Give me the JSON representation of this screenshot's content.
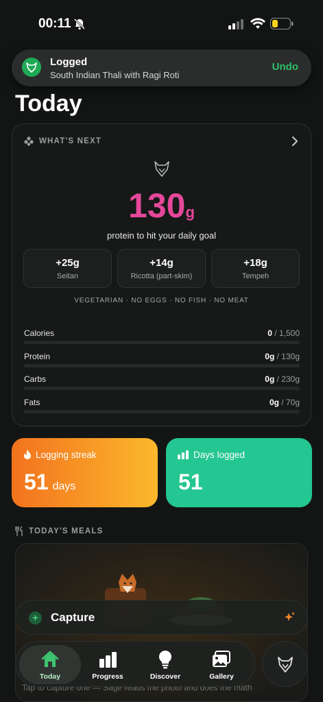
{
  "status_bar": {
    "time": "00:11",
    "icons": [
      "bell-slash-icon",
      "signal-icon",
      "wifi-icon",
      "battery-low-icon"
    ]
  },
  "toast": {
    "title": "Logged",
    "subtitle": "South Indian Thali with Ragi Roti",
    "action": "Undo"
  },
  "page_title": "Today",
  "whats_next": {
    "label": "WHAT'S NEXT",
    "protein_value": "130",
    "protein_unit": "g",
    "goal_text": "protein to hit your daily goal",
    "foods": [
      {
        "amount": "+25g",
        "name": "Seitan"
      },
      {
        "amount": "+14g",
        "name": "Ricotta (part-skim)"
      },
      {
        "amount": "+18g",
        "name": "Tempeh"
      }
    ],
    "diet": "VEGETARIAN · NO EGGS · NO FISH · NO MEAT",
    "macros": [
      {
        "label": "Calories",
        "current": "0",
        "goal": " / 1,500",
        "progress": 0
      },
      {
        "label": "Protein",
        "current": "0g",
        "goal": " / 130g",
        "progress": 0
      },
      {
        "label": "Carbs",
        "current": "0g",
        "goal": " / 230g",
        "progress": 0
      },
      {
        "label": "Fats",
        "current": "0g",
        "goal": " / 70g",
        "progress": 0
      }
    ]
  },
  "stats": {
    "streak": {
      "label": "Logging streak",
      "value": "51",
      "unit": "days"
    },
    "days_logged": {
      "label": "Days logged",
      "value": "51"
    }
  },
  "meals": {
    "label": "TODAY'S MEALS",
    "hint": "Tap to capture one — Sage reads the photo and does the math"
  },
  "capture": {
    "label": "Capture"
  },
  "tabs": [
    {
      "label": "Today",
      "icon": "home-icon",
      "active": true
    },
    {
      "label": "Progress",
      "icon": "bar-chart-icon",
      "active": false
    },
    {
      "label": "Discover",
      "icon": "lightbulb-icon",
      "active": false
    },
    {
      "label": "Gallery",
      "icon": "gallery-icon",
      "active": false
    }
  ],
  "colors": {
    "accent_green": "#2fbf6a",
    "protein_pink": "#e5479a",
    "streak_orange": "#f3731e",
    "days_teal": "#24c691"
  }
}
